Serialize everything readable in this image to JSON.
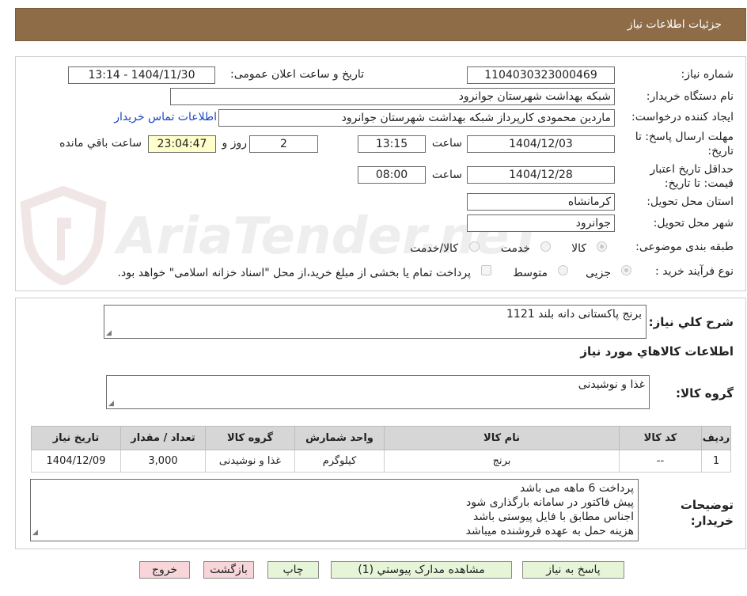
{
  "header": {
    "title": "جزئيات اطلاعات نياز"
  },
  "watermark": "AriaTender.neT",
  "form": {
    "need_number_label": "شماره نیاز:",
    "need_number": "1104030323000469",
    "announce_label": "تاریخ و ساعت اعلان عمومی:",
    "announce_value": "1404/11/30 - 13:14",
    "buyer_org_label": "نام دستگاه خریدار:",
    "buyer_org": "شبکه بهداشت شهرستان جوانرود",
    "creator_label": "ایجاد کننده درخواست:",
    "creator": "ماردین محمودی کارپرداز شبکه بهداشت شهرستان جوانرود",
    "contact_link": "اطلاعات تماس خریدار",
    "deadline_label": "مهلت ارسال پاسخ: تا تاریخ:",
    "deadline_date": "1404/12/03",
    "time_label": "ساعت",
    "deadline_time": "13:15",
    "days_value": "2",
    "days_label": "روز و",
    "remaining_time": "23:04:47",
    "remaining_label": "ساعت باقي مانده",
    "validity_label": "حداقل تاریخ اعتبار قیمت: تا تاریخ:",
    "validity_date": "1404/12/28",
    "validity_time": "08:00",
    "province_label": "استان محل تحویل:",
    "province": "کرمانشاه",
    "city_label": "شهر محل تحویل:",
    "city": "جوانرود",
    "category_label": "طبقه بندی موضوعی:",
    "category_options": [
      "کالا",
      "خدمت",
      "کالا/خدمت"
    ],
    "category_selected": "کالا",
    "process_label": "نوع فرآیند خرید :",
    "process_options": [
      "جزیی",
      "متوسط"
    ],
    "process_selected": "جزیی",
    "treasury_note": "پرداخت تمام یا بخشی از مبلغ خرید،از محل \"اسناد خزانه اسلامی\" خواهد بود."
  },
  "details": {
    "summary_label": "شرح کلي نياز:",
    "summary": "برنج پاکستانی دانه بلند 1121",
    "goods_info_title": "اطلاعات کالاهاي مورد نياز",
    "goods_group_label": "گروه کالا:",
    "goods_group": "غذا و نوشیدنی",
    "table": {
      "headers": [
        "رديف",
        "کد کالا",
        "نام کالا",
        "واحد شمارش",
        "گروه کالا",
        "تعداد / مقدار",
        "تاريخ نياز"
      ],
      "rows": [
        [
          "1",
          "--",
          "برنج",
          "کیلوگرم",
          "غذا و نوشیدنی",
          "3,000",
          "1404/12/09"
        ]
      ]
    },
    "notes_label": "توضیحات خریدار:",
    "notes": [
      "پرداخت 6 ماهه می باشد",
      "پیش فاکتور در سامانه بارگذاری شود",
      "اجناس مطابق با فایل پیوستی باشد",
      "هزینه حمل به عهده فروشنده میباشد"
    ]
  },
  "buttons": {
    "reply": "پاسخ به نياز",
    "attachments": "مشاهده مدارک پيوستي (1)",
    "print": "چاپ",
    "back": "بازگشت",
    "exit": "خروج"
  }
}
